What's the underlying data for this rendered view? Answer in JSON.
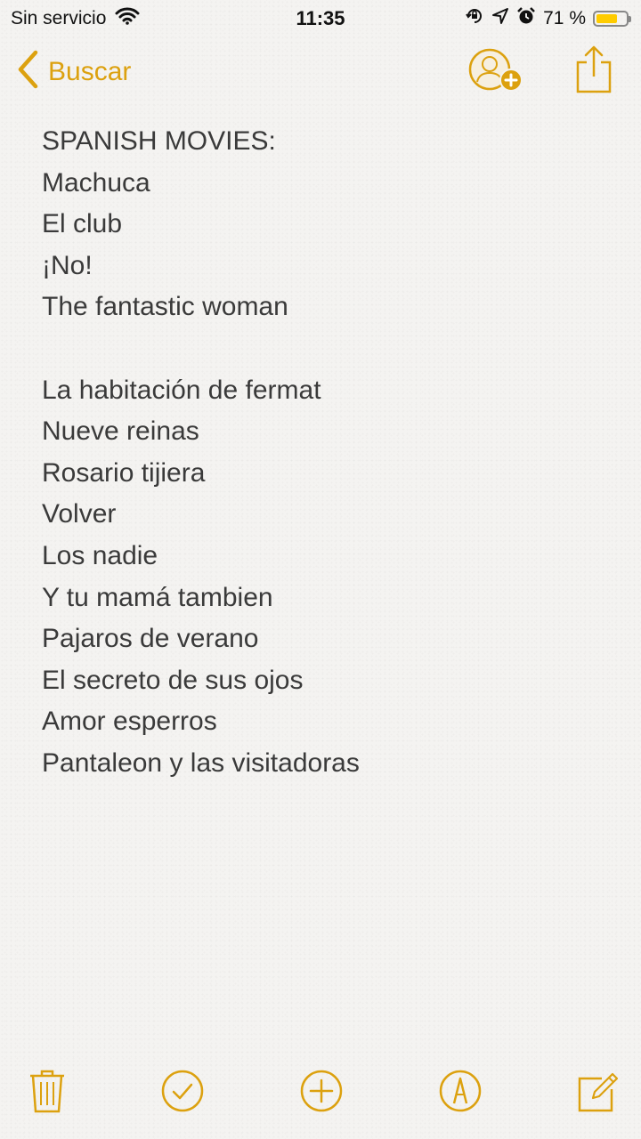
{
  "status_bar": {
    "carrier": "Sin servicio",
    "time": "11:35",
    "battery_percent": "71 %",
    "battery_level": 0.71,
    "battery_color": "#ffcc00"
  },
  "nav": {
    "back_label": "Buscar",
    "accent_color": "#dca10f"
  },
  "note": {
    "lines": [
      "SPANISH MOVIES:",
      "Machuca",
      "El club",
      "¡No!",
      "The fantastic woman",
      "",
      "La habitación de fermat",
      "Nueve reinas",
      "Rosario tijiera",
      "Volver",
      "Los nadie",
      "Y tu mamá tambien",
      "Pajaros de verano",
      "El secreto de sus ojos",
      "Amor esperros",
      "Pantaleon y las visitadoras"
    ]
  },
  "toolbar": {
    "icons": [
      "trash-icon",
      "checklist-icon",
      "add-icon",
      "markup-icon",
      "compose-icon"
    ]
  }
}
